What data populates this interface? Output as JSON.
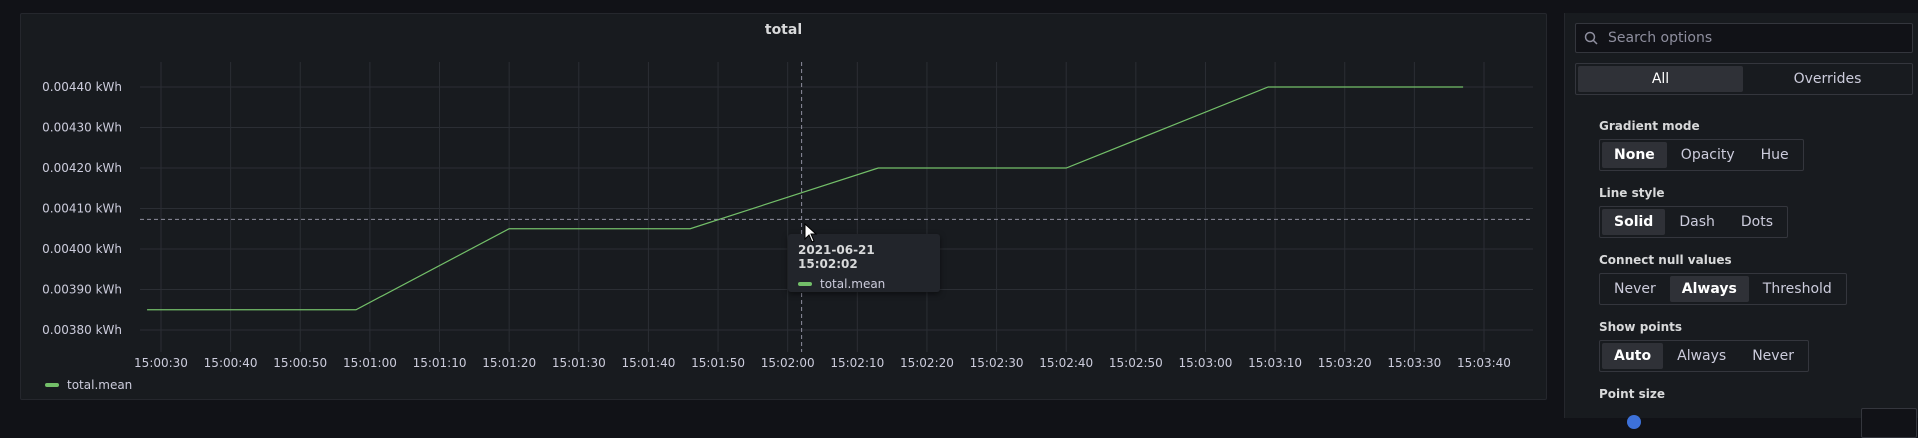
{
  "panel": {
    "title": "total",
    "legend": {
      "series_name": "total.mean",
      "color": "#73bf69"
    },
    "tooltip": {
      "time": "2021-06-21 15:02:02",
      "series": "total.mean"
    }
  },
  "chart_data": {
    "type": "line",
    "title": "total",
    "x_ticks": [
      "15:00:30",
      "15:00:40",
      "15:00:50",
      "15:01:00",
      "15:01:10",
      "15:01:20",
      "15:01:30",
      "15:01:40",
      "15:01:50",
      "15:02:00",
      "15:02:10",
      "15:02:20",
      "15:02:30",
      "15:02:40",
      "15:02:50",
      "15:03:00",
      "15:03:10",
      "15:03:20",
      "15:03:30",
      "15:03:40"
    ],
    "y_ticks": [
      "0.00380 kWh",
      "0.00390 kWh",
      "0.00400 kWh",
      "0.00410 kWh",
      "0.00420 kWh",
      "0.00430 kWh",
      "0.00440 kWh"
    ],
    "ylim": [
      0.0038,
      0.0044
    ],
    "grid": true,
    "series": [
      {
        "name": "total.mean",
        "color": "#73bf69",
        "x": [
          "15:00:28",
          "15:00:58",
          "15:01:20",
          "15:01:46",
          "15:02:13",
          "15:02:40",
          "15:03:09",
          "15:03:37"
        ],
        "values": [
          0.00385,
          0.00385,
          0.00405,
          0.00405,
          0.0042,
          0.0042,
          0.0044,
          0.0044
        ]
      }
    ],
    "crosshair": {
      "x": "15:02:02",
      "y": 0.004073
    }
  },
  "options": {
    "search_placeholder": "Search options",
    "tabs": [
      "All",
      "Overrides"
    ],
    "gradient_mode": {
      "label": "Gradient mode",
      "options": [
        "None",
        "Opacity",
        "Hue"
      ],
      "selected": "None"
    },
    "line_style": {
      "label": "Line style",
      "options": [
        "Solid",
        "Dash",
        "Dots"
      ],
      "selected": "Solid"
    },
    "connect_null": {
      "label": "Connect null values",
      "options": [
        "Never",
        "Always",
        "Threshold"
      ],
      "selected": "Always"
    },
    "show_points": {
      "label": "Show points",
      "options": [
        "Auto",
        "Always",
        "Never"
      ],
      "selected": "Auto"
    },
    "point_size": {
      "label": "Point size"
    }
  }
}
